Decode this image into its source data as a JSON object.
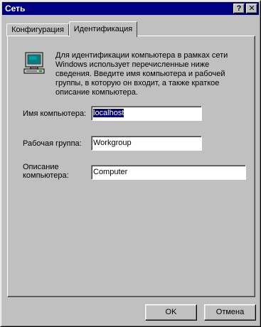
{
  "window": {
    "title": "Сеть",
    "help_button": "?",
    "close_button": "✕"
  },
  "tabs": [
    {
      "label": "Конфигурация",
      "active": false
    },
    {
      "label": "Идентификация",
      "active": true
    }
  ],
  "identification": {
    "icon": "computer-icon",
    "description": "Для идентификации компьютера в рамках сети Windows использует перечисленные ниже сведения. Введите имя компьютера и рабочей группы, в которую он входит, а также краткое описание компьютера.",
    "computer_name_label": "Имя компьютера:",
    "computer_name_value": "localhost",
    "workgroup_label": "Рабочая группа:",
    "workgroup_value": "Workgroup",
    "description_label_line1": "Описание",
    "description_label_line2": "компьютера:",
    "description_value": "Computer"
  },
  "buttons": {
    "ok": "OK",
    "cancel": "Отмена"
  },
  "colors": {
    "titlebar": "#000080",
    "face": "#c0c0c0"
  }
}
